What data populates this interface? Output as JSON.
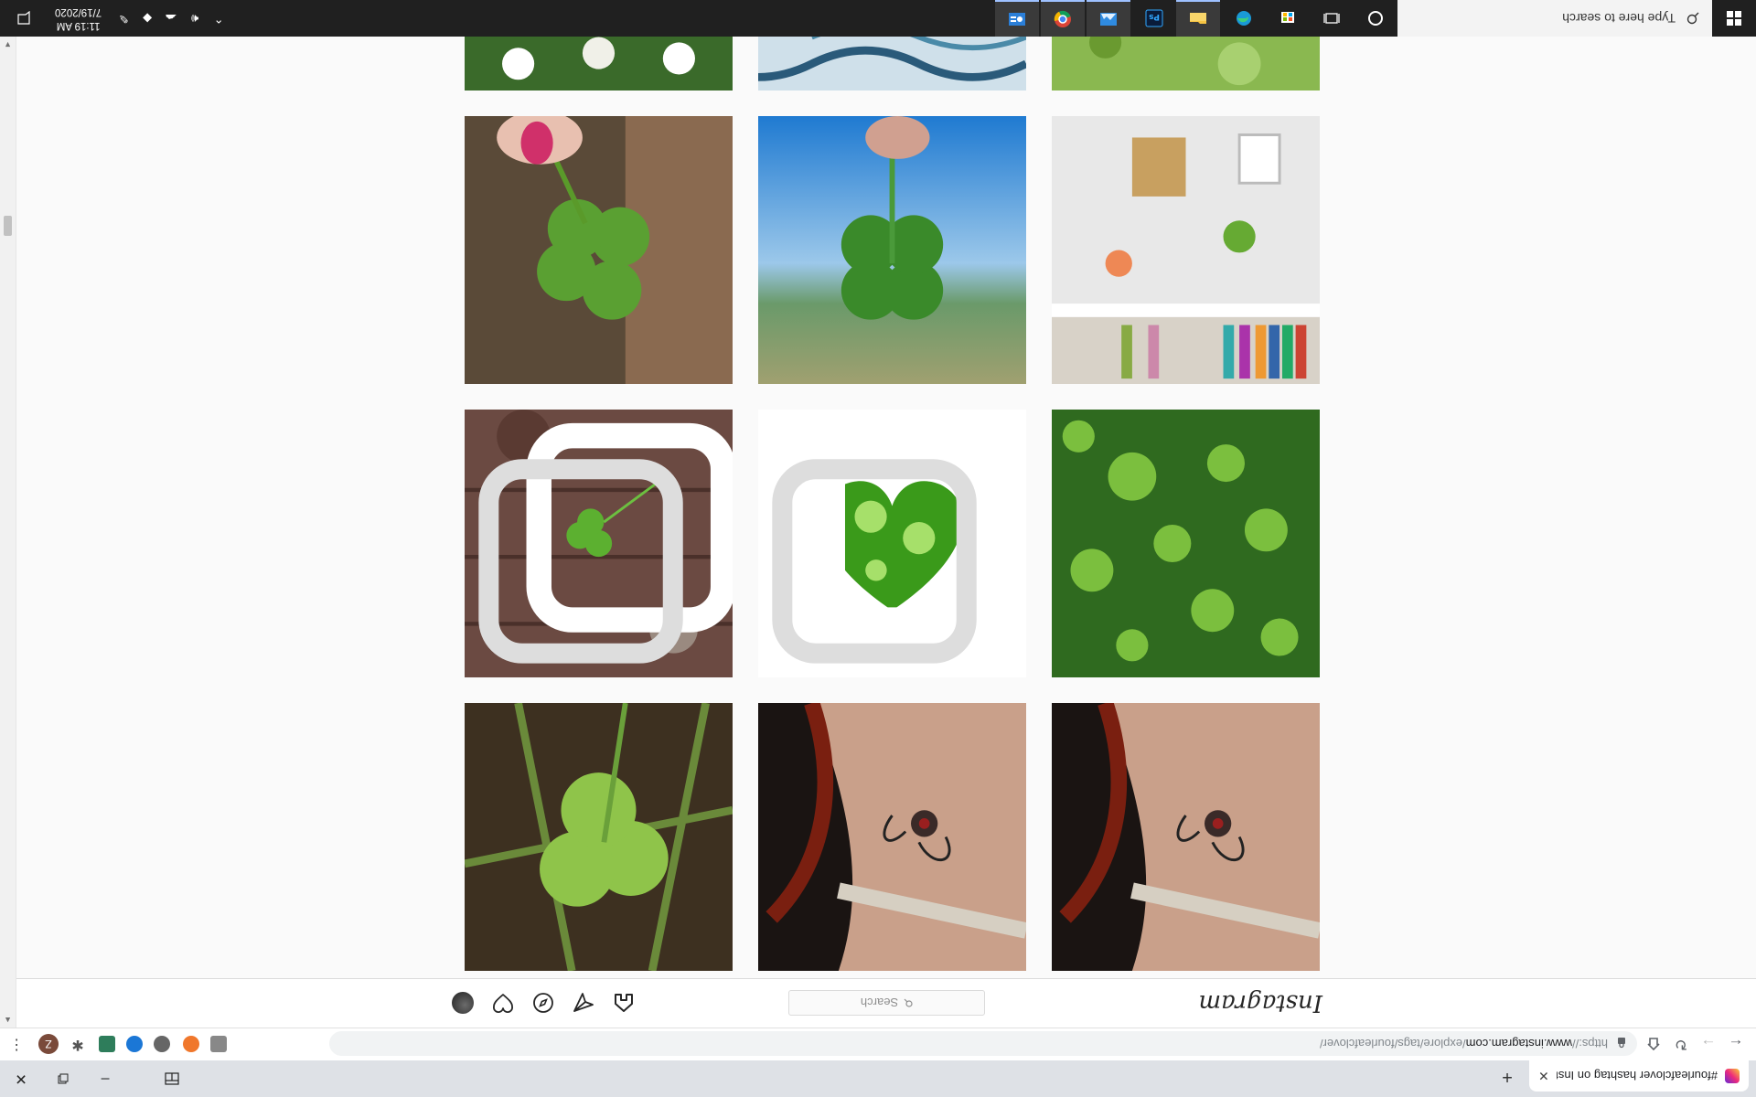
{
  "browser": {
    "tab_title": "#fourleafclover hashtag on Inst",
    "url_proto": "https://",
    "url_host": "www.instagram.com",
    "url_path": "/explore/tags/fourleafclover/",
    "profile_initial": "Z"
  },
  "instagram": {
    "logo": "Instagram",
    "search_placeholder": "Search"
  },
  "taskbar": {
    "search_placeholder": "Type here to search",
    "time": "11:19 AM",
    "date": "7/19/2020"
  },
  "colors": {
    "chrome_bg": "#dee1e6",
    "taskbar_bg": "#202020",
    "page_bg": "#fafafa",
    "accent": "#1a73e8"
  },
  "icons": [
    "close-icon",
    "plus-icon",
    "back-icon",
    "forward-icon",
    "reload-icon",
    "home-icon",
    "lock-icon",
    "home-icon",
    "direct-icon",
    "explore-icon",
    "heart-icon",
    "search-icon",
    "windows-icon",
    "cortana-icon",
    "task-view-icon",
    "chevron-up-icon",
    "volume-icon",
    "network-icon",
    "notification-icon"
  ]
}
